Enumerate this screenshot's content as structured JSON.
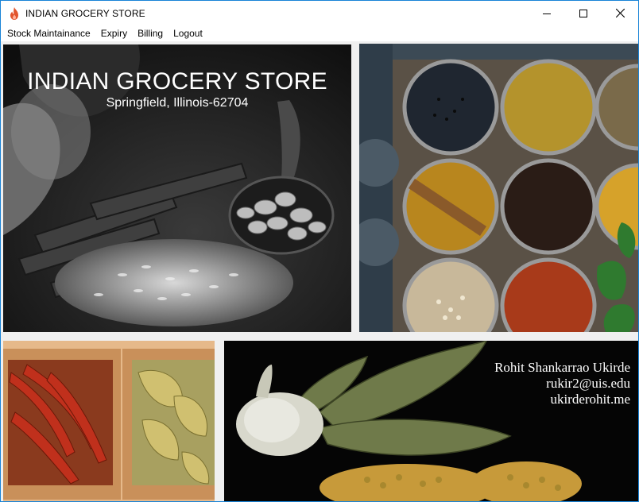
{
  "window": {
    "title": "INDIAN GROCERY STORE",
    "icon": "flame-icon",
    "controls": [
      "minimize-icon",
      "maximize-icon",
      "close-icon"
    ]
  },
  "menu": {
    "items": [
      "Stock Maintainance",
      "Expiry",
      "Billing",
      "Logout"
    ]
  },
  "banner": {
    "title": "INDIAN GROCERY STORE",
    "subtitle": "Springfield, Illinois-62704"
  },
  "credits": {
    "name": "Rohit Shankarrao Ukirde",
    "email": "rukir2@uis.edu",
    "website": "ukirderohit.me"
  },
  "colors": {
    "window_border": "#1883d7",
    "icon_flame": "#e2552d",
    "overlay_text": "#ffffff"
  }
}
